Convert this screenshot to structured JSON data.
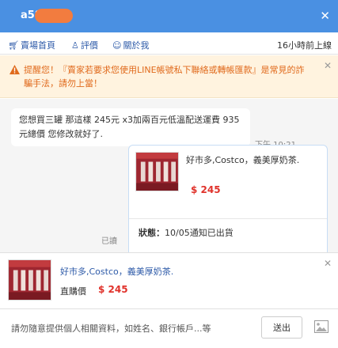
{
  "header": {
    "title": "a58"
  },
  "nav": {
    "items": [
      {
        "label": "賣場首頁",
        "icon": "cart-icon"
      },
      {
        "label": "評價",
        "icon": "person-icon"
      },
      {
        "label": "關於我",
        "icon": "smile-icon"
      }
    ],
    "status": "16小時前上線"
  },
  "warning": {
    "text": "提醒您！『賣家若要求您使用LINE帳號私下聯絡或轉帳匯款』是常見的詐騙手法，請勿上當！"
  },
  "chat": {
    "incoming": {
      "text": "您想買三罐 那這樣 245元 x3加兩百元低溫配送運費 935元總價 您修改就好了.",
      "time": "下午 10:21"
    },
    "card": {
      "product_name": "好市多,Costco，義美厚奶茶.",
      "price": "$ 245",
      "shipping_label": "狀態：",
      "shipping_value": "10/05通知已出貨"
    },
    "read_status": "已讀"
  },
  "pinned_product": {
    "name": "好市多,Costco，義美厚奶茶.",
    "price_label": "直購價",
    "price": "$ 245"
  },
  "composer": {
    "placeholder": "請勿隨意提供個人相關資料，如姓名、銀行帳戶...等",
    "send_label": "送出"
  },
  "colors": {
    "header_bg": "#4a90e2",
    "link": "#2d5aa8",
    "price": "#e0322b",
    "warning_text": "#e06a1c",
    "warning_bg": "#fff3df"
  }
}
